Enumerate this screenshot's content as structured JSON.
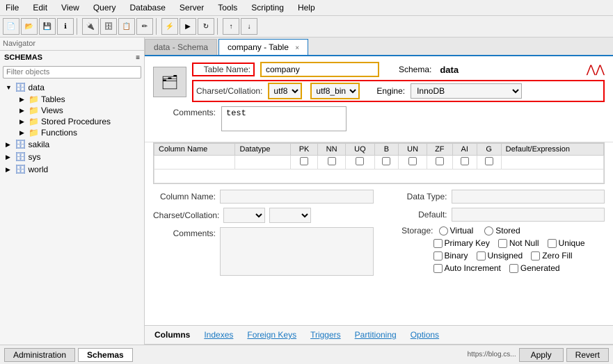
{
  "menubar": {
    "items": [
      "File",
      "Edit",
      "View",
      "Query",
      "Database",
      "Server",
      "Tools",
      "Scripting",
      "Help"
    ]
  },
  "toolbar": {
    "buttons": [
      "new",
      "open",
      "save",
      "info",
      "db-connect",
      "db-new",
      "table-new",
      "table-edit",
      "query",
      "execute",
      "refresh",
      "arrow-up",
      "arrow-down"
    ]
  },
  "navigator": {
    "title": "Navigator",
    "schemas_label": "SCHEMAS",
    "filter_placeholder": "Filter objects",
    "tree": {
      "data": {
        "label": "data",
        "children": [
          "Tables",
          "Views",
          "Stored Procedures",
          "Functions"
        ]
      },
      "sakila": {
        "label": "sakila"
      },
      "sys": {
        "label": "sys"
      },
      "world": {
        "label": "world"
      }
    }
  },
  "tabs": {
    "inactive_tab": "data - Schema",
    "active_tab": "company - Table",
    "close_label": "×"
  },
  "table_form": {
    "table_name_label": "Table Name:",
    "table_name_value": "company",
    "schema_label": "Schema:",
    "schema_value": "data",
    "charset_label": "Charset/Collation:",
    "charset_value": "utf8",
    "collation_value": "utf8_bin",
    "engine_label": "Engine:",
    "engine_value": "InnoDB",
    "comments_label": "Comments:",
    "comments_value": "test"
  },
  "columns_table": {
    "headers": [
      "Column Name",
      "Datatype",
      "PK",
      "NN",
      "UQ",
      "B",
      "UN",
      "ZF",
      "AI",
      "G",
      "Default/Expression"
    ]
  },
  "column_editor": {
    "column_name_label": "Column Name:",
    "column_name_value": "",
    "charset_label": "Charset/Collation:",
    "comments_label": "Comments:",
    "data_type_label": "Data Type:",
    "data_type_value": "",
    "default_label": "Default:",
    "default_value": "",
    "storage_label": "Storage:",
    "storage_options": [
      "Virtual",
      "Stored"
    ],
    "checkboxes": {
      "primary_key": "Primary Key",
      "not_null": "Not Null",
      "unique": "Unique",
      "binary": "Binary",
      "unsigned": "Unsigned",
      "zero_fill": "Zero Fill",
      "auto_increment": "Auto Increment",
      "generated": "Generated"
    }
  },
  "bottom_tabs": {
    "items": [
      "Columns",
      "Indexes",
      "Foreign Keys",
      "Triggers",
      "Partitioning",
      "Options"
    ],
    "active": "Columns"
  },
  "footer": {
    "tabs": [
      "Administration",
      "Schemas"
    ],
    "active_tab": "Schemas",
    "link": "https://blog.cs...",
    "apply_btn": "Apply",
    "revert_btn": "Revert"
  }
}
